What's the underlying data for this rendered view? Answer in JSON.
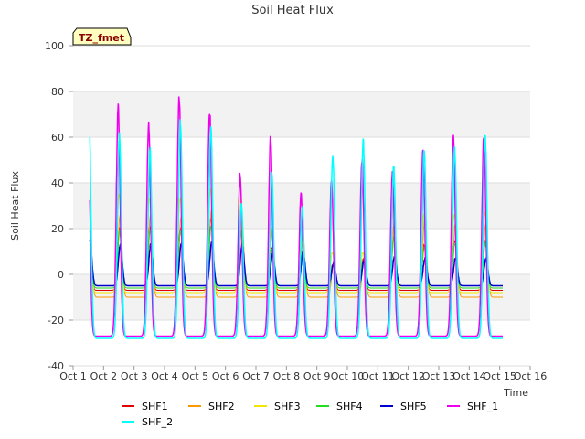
{
  "chart_data": {
    "type": "line",
    "title": "Soil Heat Flux",
    "xlabel": "Time",
    "ylabel": "Soil Heat Flux",
    "badge": "TZ_fmet",
    "x_ticks": [
      "Oct 1",
      "Oct 2",
      "Oct 3",
      "Oct 4",
      "Oct 5",
      "Oct 6",
      "Oct 7",
      "Oct 8",
      "Oct 9",
      "Oct 10",
      "Oct 11",
      "Oct 12",
      "Oct 13",
      "Oct 14",
      "Oct 15",
      "Oct 16"
    ],
    "xlim": [
      1,
      16
    ],
    "ylim": [
      -40,
      100
    ],
    "y_ticks": [
      -40,
      -20,
      0,
      20,
      40,
      60,
      80,
      100
    ],
    "grid": "horizontal bands",
    "legend_position": "bottom",
    "day_start": 1.55,
    "day_end": 15.1,
    "series": [
      {
        "name": "SHF1",
        "color": "#e00000",
        "base": -7,
        "amp": [
          22,
          20,
          21,
          20,
          24,
          21,
          11,
          10,
          4,
          7,
          16,
          13,
          15,
          15,
          17,
          16
        ],
        "width": 1
      },
      {
        "name": "SHF2",
        "color": "#ff9900",
        "base": -10,
        "amp": [
          29,
          26,
          26,
          25,
          28,
          25,
          20,
          18,
          4,
          6,
          24,
          25,
          22,
          22,
          24,
          24
        ],
        "width": 1
      },
      {
        "name": "SHF3",
        "color": "#f2e600",
        "base": -8,
        "amp": [
          40,
          35,
          34,
          33,
          37,
          33,
          20,
          14,
          10,
          10,
          30,
          26,
          26,
          27,
          30,
          30
        ],
        "width": 1
      },
      {
        "name": "SHF4",
        "color": "#22dd22",
        "base": -6,
        "amp": [
          21,
          19,
          19,
          19,
          21,
          19,
          11,
          9,
          4,
          5,
          16,
          12,
          13,
          14,
          15,
          15
        ],
        "width": 1
      },
      {
        "name": "SHF5",
        "color": "#0000cc",
        "base": -5,
        "amp": [
          15,
          13,
          13,
          13,
          14,
          13,
          9,
          10,
          5,
          6,
          8,
          7,
          7,
          7,
          9,
          9
        ],
        "width": 1.5
      },
      {
        "name": "SHF_1",
        "color": "#ee00ee",
        "base": -27,
        "amp": [
          84,
          73,
          66,
          78,
          72,
          44,
          60,
          35,
          41,
          50,
          44,
          53,
          60,
          61,
          60,
          60
        ],
        "width": 1.5
      },
      {
        "name": "SHF_2",
        "color": "#00ffff",
        "base": -28,
        "amp": [
          70,
          61,
          55,
          67,
          63,
          31,
          45,
          30,
          52,
          58,
          47,
          55,
          55,
          61,
          61,
          61
        ],
        "width": 1.5
      }
    ]
  }
}
